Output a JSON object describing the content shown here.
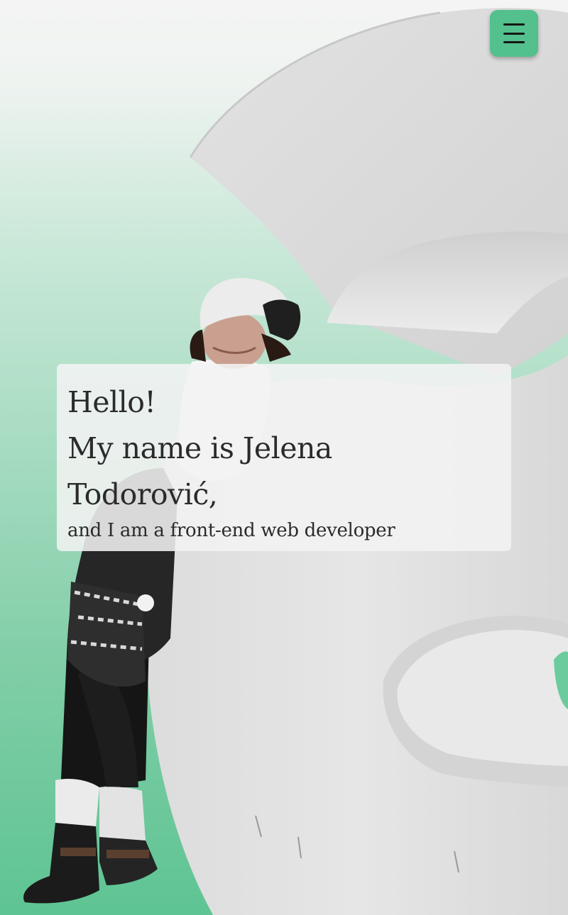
{
  "header": {
    "menu_icon": "hamburger-menu-icon",
    "menu_color": "#53c08d"
  },
  "hero": {
    "greeting": "Hello!",
    "name_line_1": "My name is Jelena",
    "name_line_2": "Todorović,",
    "tagline": "and I am a front-end web developer"
  },
  "colors": {
    "accent": "#53c08d",
    "gradient_top": "#f4f4f4",
    "gradient_bottom": "#5ec493",
    "text": "#2b2b2b"
  }
}
